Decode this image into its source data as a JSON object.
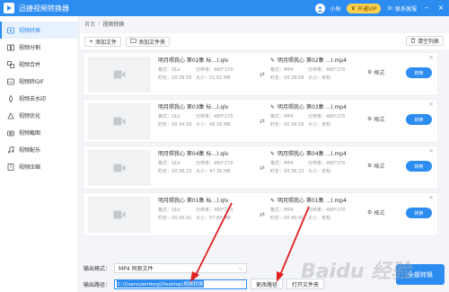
{
  "app": {
    "title": "迅捷视频转换器",
    "user": "小秋",
    "vip": "开通VIP",
    "service": "联系客服",
    "win_min": "–",
    "win_close": "×"
  },
  "sidebar": {
    "items": [
      {
        "label": "视频转换",
        "icon": "convert-icon"
      },
      {
        "label": "视频分割",
        "icon": "split-icon"
      },
      {
        "label": "视频合并",
        "icon": "merge-icon"
      },
      {
        "label": "视频转GIF",
        "icon": "gif-icon"
      },
      {
        "label": "视频去水印",
        "icon": "watermark-icon"
      },
      {
        "label": "视频优化",
        "icon": "optimize-icon"
      },
      {
        "label": "视频截图",
        "icon": "screenshot-icon"
      },
      {
        "label": "视频配乐",
        "icon": "music-icon"
      },
      {
        "label": "视频压缩",
        "icon": "compress-icon"
      }
    ]
  },
  "breadcrumb": {
    "home": "首页",
    "sep": "›",
    "current": "视频转换"
  },
  "toolbar": {
    "add_file": "添加文件",
    "add_folder": "添加文件夹",
    "clear_list": "清空列表"
  },
  "meta_labels": {
    "format": "格式：",
    "resolution": "分辨率：",
    "duration": "时长：",
    "size": "大小："
  },
  "files": [
    {
      "src_name": "明月照我心 第02集 标...).qlv",
      "src_format": "QLV",
      "src_res": "480*270",
      "src_dur": "00:39:58",
      "src_size": "51.92 MB",
      "dst_name": "明月照我心 第02集 ...).mp4",
      "dst_format": "MP4",
      "dst_res": "480*270",
      "dst_dur": "00:39:58",
      "dst_size": "未知",
      "settings": "格式",
      "convert": "转换"
    },
    {
      "src_name": "明月照我心 第03集 标...).qlv",
      "src_format": "QLV",
      "src_res": "480*270",
      "src_dur": "00:34:59",
      "src_size": "46.26 MB",
      "dst_name": "明月照我心 第03集 ...).mp4",
      "dst_format": "MP4",
      "dst_res": "480*270",
      "dst_dur": "00:34:59",
      "dst_size": "未知",
      "settings": "格式",
      "convert": "转换"
    },
    {
      "src_name": "明月照我心 第04集 标...).qlv",
      "src_format": "QLV",
      "src_res": "480*270",
      "src_dur": "00:36:23",
      "src_size": "47.35 MB",
      "dst_name": "明月照我心 第04集 ...).mp4",
      "dst_format": "MP4",
      "dst_res": "480*270",
      "dst_dur": "00:36:23",
      "dst_size": "未知",
      "settings": "格式",
      "convert": "转换"
    },
    {
      "src_name": "明月照我心 第01集 标...).qlv",
      "src_format": "QLV",
      "src_res": "480*270",
      "src_dur": "00:40:41",
      "src_size": "57.84 MB",
      "dst_name": "明月照我心 第01集 ...).mp4",
      "dst_format": "MP4",
      "dst_res": "480*270",
      "dst_dur": "00:40:41",
      "dst_size": "未知",
      "settings": "格式",
      "convert": "转换"
    }
  ],
  "bottom": {
    "format_label": "输出格式：",
    "format_value": "MP4  同原文件",
    "path_label": "输出路径：",
    "path_value": "C:\\Users\\zenfeng\\Desktop\\视频转换",
    "change_path": "更改路径",
    "open_folder": "打开文件夹",
    "convert_all": "全部转换"
  },
  "watermark": "Baidu 经验",
  "colors": {
    "accent": "#2d8cf0",
    "annotation": "#e02020",
    "vip": "#ffd24d"
  }
}
